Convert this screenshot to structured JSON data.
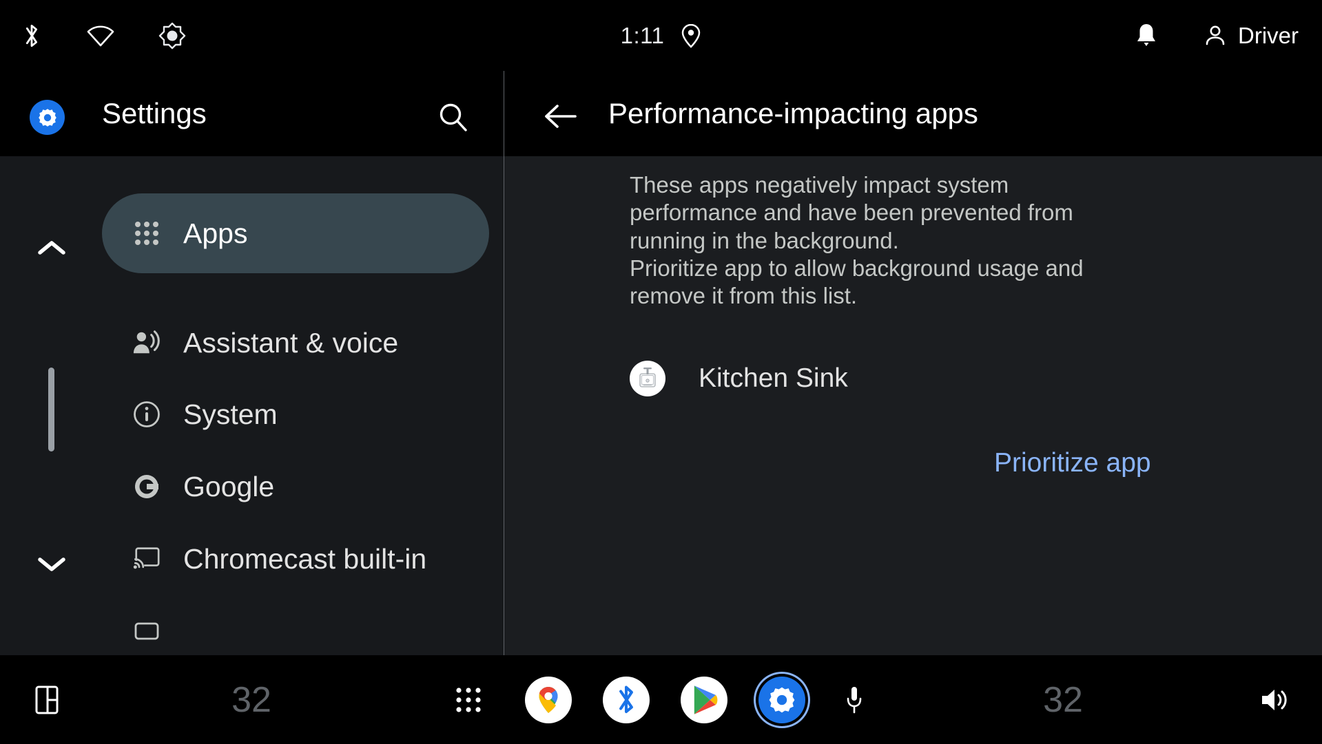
{
  "status_bar": {
    "left_icons": [
      {
        "name": "bluetooth-icon",
        "label": "Bluetooth"
      },
      {
        "name": "wifi-icon",
        "label": "Wi-Fi"
      },
      {
        "name": "brightness-icon",
        "label": "Brightness"
      }
    ],
    "time": "1:11",
    "location_icon": "location-pin-icon",
    "notification_icon": "bell-icon",
    "user_icon": "person-icon",
    "user_label": "Driver"
  },
  "left_pane": {
    "app_icon": "settings-gear-icon",
    "title": "Settings",
    "search_icon": "search-icon",
    "scroll_up_icon": "chevron-up-icon",
    "scroll_down_icon": "chevron-down-icon",
    "nav_items": [
      {
        "label": "Apps",
        "icon": "apps-grid-icon",
        "selected": true
      },
      {
        "label": "Assistant & voice",
        "icon": "assistant-voice-icon",
        "selected": false
      },
      {
        "label": "System",
        "icon": "info-circle-icon",
        "selected": false
      },
      {
        "label": "Google",
        "icon": "google-g-icon",
        "selected": false
      },
      {
        "label": "Chromecast built-in",
        "icon": "cast-icon",
        "selected": false
      }
    ]
  },
  "right_pane": {
    "back_icon": "back-arrow-icon",
    "title": "Performance-impacting apps",
    "description": "These apps negatively impact system performance and have been prevented from running in the background.\nPrioritize app to allow background usage and remove it from this list.",
    "app_row": {
      "icon": "kitchen-sink-app-icon",
      "name": "Kitchen Sink",
      "action_label": "Prioritize app"
    }
  },
  "nav_bar": {
    "panel_icon": "split-panel-icon",
    "temp_left": "32",
    "apps_icon": "apps-grid-icon",
    "shortcuts": [
      {
        "name": "maps-icon",
        "label": "Maps"
      },
      {
        "name": "bluetooth-icon",
        "label": "Bluetooth"
      },
      {
        "name": "play-store-icon",
        "label": "Play Store"
      },
      {
        "name": "settings-gear-icon",
        "label": "Settings",
        "selected": true
      }
    ],
    "mic_icon": "microphone-icon",
    "temp_right": "32",
    "volume_icon": "volume-icon"
  },
  "colors": {
    "accent_blue": "#1a73e8",
    "link_blue": "#8ab4f8",
    "selected_nav_bg": "#37474f",
    "left_pane_bg": "#17191c",
    "right_pane_bg": "#1b1d20"
  }
}
